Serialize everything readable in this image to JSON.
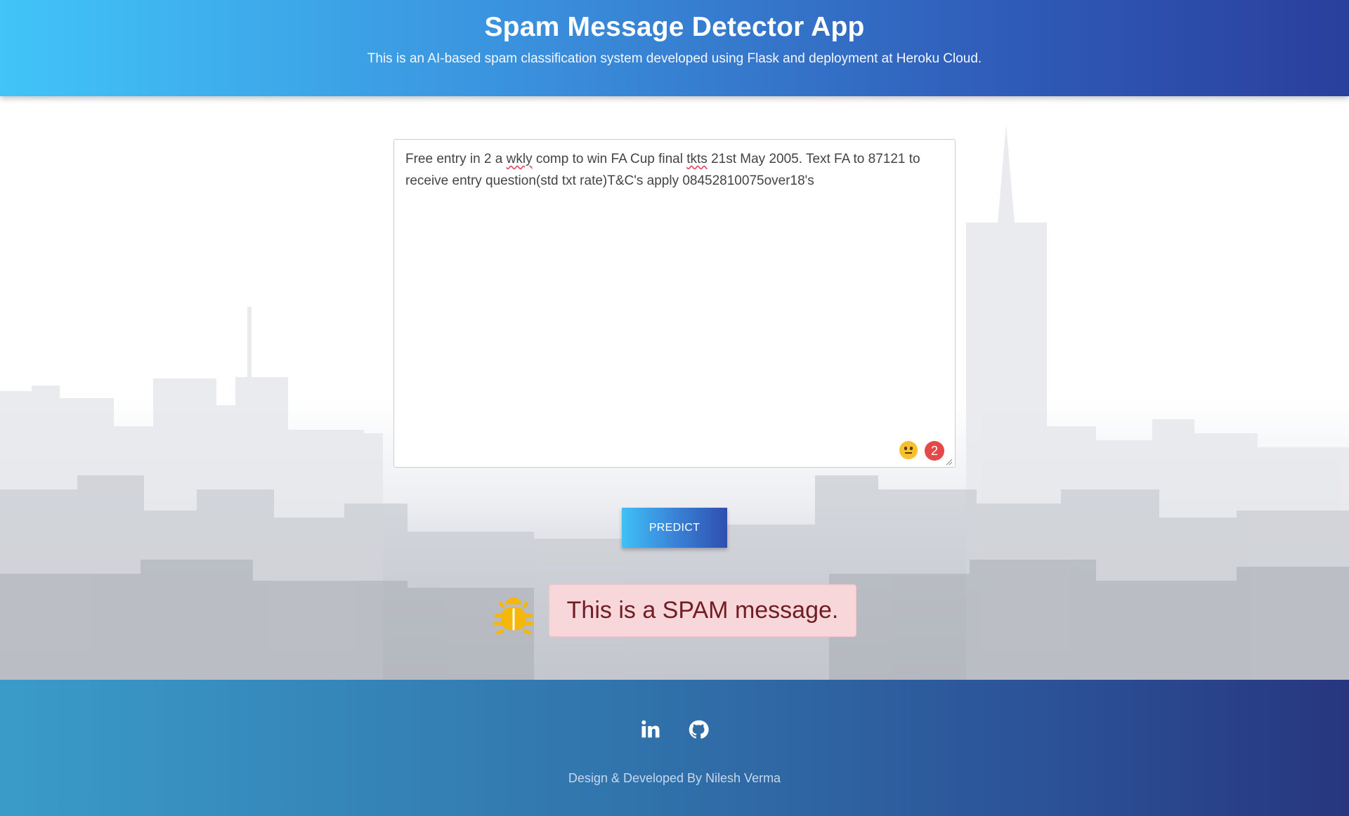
{
  "header": {
    "title": "Spam Message Detector App",
    "subtitle": "This is an AI-based spam classification system developed using Flask and deployment at Heroku Cloud."
  },
  "form": {
    "message_parts": [
      "Free entry in 2 a ",
      "wkly",
      " comp to win FA Cup final ",
      "tkts",
      " 21st May 2005. Text FA to 87121 to receive entry question(std txt rate)T&C's apply 08452810075over18's"
    ],
    "extension_badge_count": "2",
    "predict_label": "PREDICT"
  },
  "result": {
    "text": "This is a SPAM message.",
    "icon": "bug-icon",
    "status_color": "#721c24",
    "status_bg": "#f8d7da"
  },
  "footer": {
    "social": [
      {
        "name": "linkedin",
        "label": "in"
      },
      {
        "name": "github",
        "icon": "github-icon"
      }
    ],
    "credit": "Design & Developed By Nilesh Verma"
  },
  "colors": {
    "accent_start": "#41c4f8",
    "accent_end": "#2a3f9c",
    "bug_icon": "#f5b70c"
  }
}
